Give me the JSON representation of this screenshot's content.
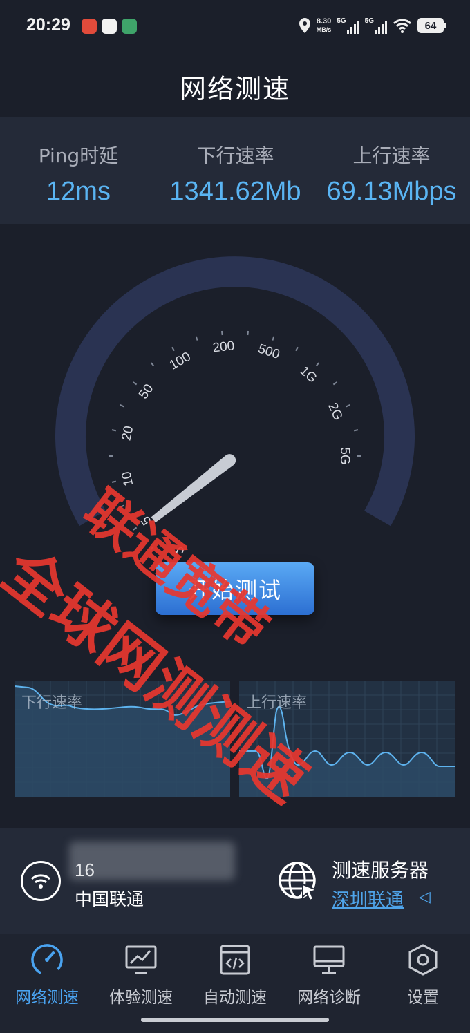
{
  "status_bar": {
    "time": "20:29",
    "net_speed_value": "8.30",
    "net_speed_unit": "MB/s",
    "signal1": "5G",
    "signal2": "5G",
    "battery": "64"
  },
  "page_title": "网络测速",
  "metrics": [
    {
      "label": "Ping时延",
      "value": "12ms"
    },
    {
      "label": "下行速率",
      "value": "1341.62Mb"
    },
    {
      "label": "上行速率",
      "value": "69.13Mbps"
    }
  ],
  "gauge": {
    "tick_labels": [
      "0",
      "5",
      "10",
      "20",
      "50",
      "100",
      "200",
      "500",
      "1G",
      "2G",
      "5G"
    ],
    "needle_value_mbps": 1341.62,
    "colors": {
      "ring": "#2a3352",
      "needle": "#c8ccd4"
    }
  },
  "start_button_label": "开始测试",
  "watermark": {
    "line1": "联通宽带",
    "line2": "全球网测测速",
    "color": "#e8372f"
  },
  "charts": {
    "download_title": "下行速率",
    "upload_title": "上行速率"
  },
  "info": {
    "ip": "16",
    "isp": "中国联通",
    "server_label": "测速服务器",
    "server_value": "深圳联通",
    "server_caret": "◁"
  },
  "nav": [
    {
      "label": "网络测速",
      "icon": "speedometer-icon",
      "active": true
    },
    {
      "label": "体验测速",
      "icon": "chart-monitor-icon",
      "active": false
    },
    {
      "label": "自动测速",
      "icon": "code-window-icon",
      "active": false
    },
    {
      "label": "网络诊断",
      "icon": "monitor-icon",
      "active": false
    },
    {
      "label": "设置",
      "icon": "hexagon-gear-icon",
      "active": false
    }
  ],
  "accent_color": "#4aa3f0"
}
